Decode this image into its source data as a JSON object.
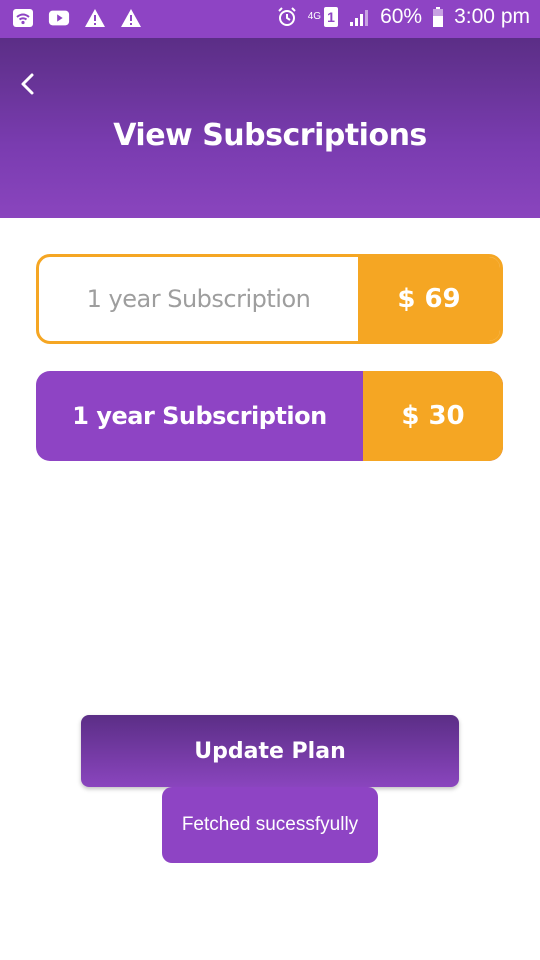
{
  "status_bar": {
    "battery": "60%",
    "time": "3:00 pm",
    "network": "4G",
    "sim": "1"
  },
  "header": {
    "title": "View Subscriptions"
  },
  "subscriptions": [
    {
      "label": "1 year Subscription",
      "price": "$ 69"
    },
    {
      "label": "1 year Subscription",
      "price": "$ 30"
    }
  ],
  "actions": {
    "update_label": "Update Plan"
  },
  "toast": {
    "message": "Fetched sucessfyully"
  },
  "colors": {
    "primary": "#8e44c4",
    "primary_dark": "#5b2e86",
    "accent": "#f5a623"
  }
}
